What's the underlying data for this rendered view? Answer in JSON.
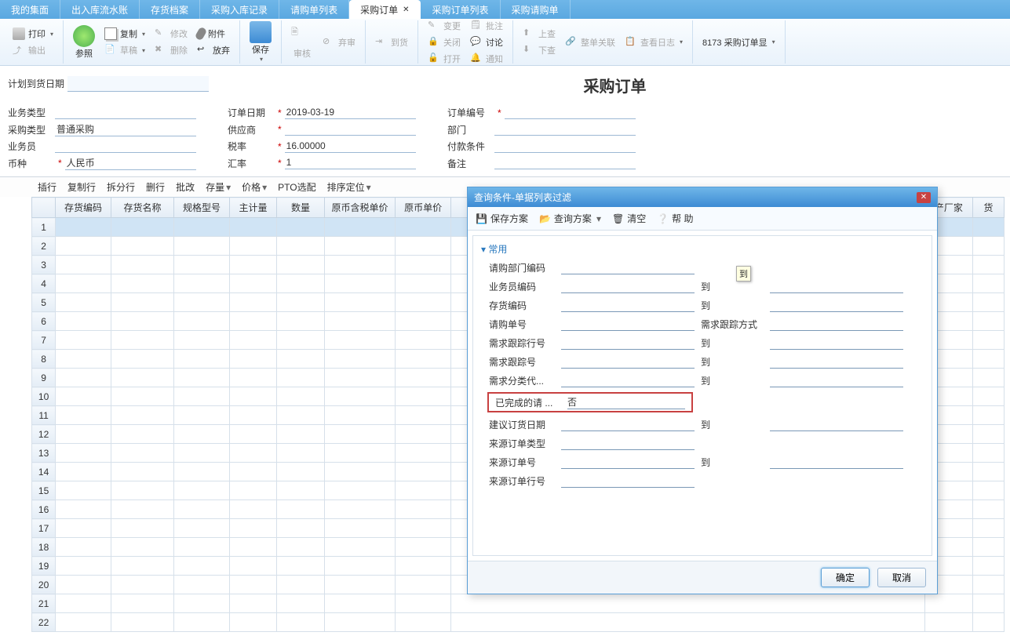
{
  "tabs": [
    "我的集面",
    "出入库流水账",
    "存货档案",
    "采购入库记录",
    "请购单列表",
    "采购订单",
    "采购订单列表",
    "采购请购单"
  ],
  "active_tab": 5,
  "ribbon": {
    "print": "打印",
    "output": "输出",
    "ref": "参照",
    "copy": "复制",
    "modify": "修改",
    "attach": "附件",
    "draft": "草稿",
    "delete": "删除",
    "discard": "放弃",
    "save": "保存",
    "review": "审核",
    "abandon": "弃审",
    "arrive": "到货",
    "change": "变更",
    "close": "关闭",
    "open": "打开",
    "submit": "批注",
    "discuss": "讨论",
    "notify": "通知",
    "up": "上查",
    "full": "整单关联",
    "log": "查看日志",
    "down": "下查",
    "viewsel": "8173 采购订单显"
  },
  "plan_label": "计划到货日期",
  "title": "采购订单",
  "form": {
    "biz_type": {
      "label": "业务类型",
      "val": ""
    },
    "order_date": {
      "label": "订单日期",
      "val": "2019-03-19"
    },
    "order_no": {
      "label": "订单编号",
      "val": ""
    },
    "purchase_type": {
      "label": "采购类型",
      "val": "普通采购"
    },
    "supplier": {
      "label": "供应商",
      "val": ""
    },
    "dept": {
      "label": "部门",
      "val": ""
    },
    "operator": {
      "label": "业务员",
      "val": ""
    },
    "tax_rate": {
      "label": "税率",
      "val": "16.00000"
    },
    "pay_term": {
      "label": "付款条件",
      "val": ""
    },
    "currency": {
      "label": "币种",
      "val": "人民币"
    },
    "exchange": {
      "label": "汇率",
      "val": "1"
    },
    "remark": {
      "label": "备注",
      "val": ""
    }
  },
  "tbl_toolbar": [
    "插行",
    "复制行",
    "拆分行",
    "删行",
    "批改",
    "存量",
    "价格",
    "PTO选配",
    "排序定位"
  ],
  "columns": [
    "",
    "存货编码",
    "存货名称",
    "规格型号",
    "主计量",
    "数量",
    "原币含税单价",
    "原币单价",
    "",
    "产厂家",
    "货"
  ],
  "rows": 22,
  "dialog": {
    "title": "查询条件-单据列表过滤",
    "tb": {
      "save": "保存方案",
      "query": "查询方案",
      "clear": "清空",
      "help": "帮 助"
    },
    "section": "常用",
    "fields": [
      {
        "label": "请购部门编码",
        "to": ""
      },
      {
        "label": "业务员编码",
        "to": "到"
      },
      {
        "label": "存货编码",
        "to": "到"
      },
      {
        "label": "请购单号",
        "to": "需求跟踪方式"
      },
      {
        "label": "需求跟踪行号",
        "to": "到"
      },
      {
        "label": "需求跟踪号",
        "to": "到"
      },
      {
        "label": "需求分类代...",
        "to": "到"
      },
      {
        "label": "已完成的请 ...",
        "val": "否",
        "to": "",
        "hl": true
      },
      {
        "label": "建议订货日期",
        "to": "到"
      },
      {
        "label": "来源订单类型",
        "to": ""
      },
      {
        "label": "来源订单号",
        "to": "到"
      },
      {
        "label": "来源订单行号",
        "to": ""
      }
    ],
    "tooltip_text": "到",
    "ok": "确定",
    "cancel": "取消"
  }
}
